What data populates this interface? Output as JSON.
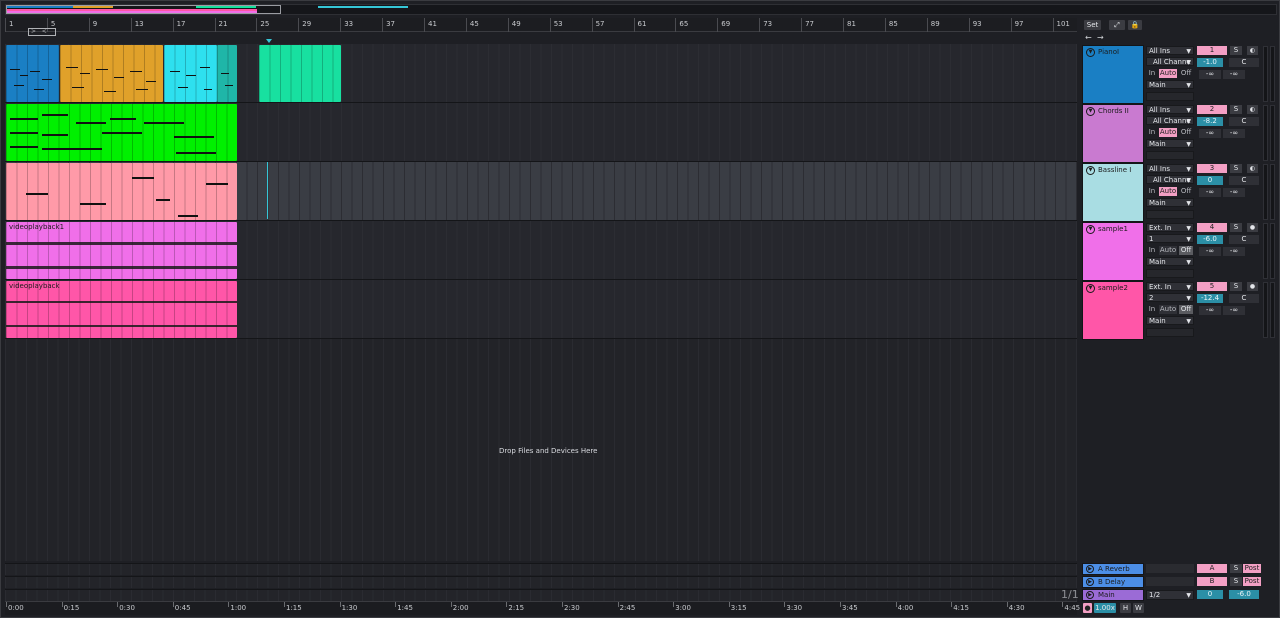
{
  "ruler": {
    "bars": [
      "1",
      "5",
      "9",
      "13",
      "17",
      "21",
      "25",
      "29",
      "33",
      "37",
      "41",
      "45",
      "49",
      "53",
      "57",
      "61",
      "65",
      "69",
      "73",
      "77",
      "81",
      "85",
      "89",
      "93",
      "97",
      "101"
    ]
  },
  "timeline": {
    "labels": [
      "0:00",
      "0:15",
      "0:30",
      "0:45",
      "1:00",
      "1:15",
      "1:30",
      "1:45",
      "2:00",
      "2:15",
      "2:30",
      "2:45",
      "3:00",
      "3:15",
      "3:30",
      "3:45",
      "4:00",
      "4:15",
      "4:30",
      "4:45"
    ]
  },
  "tracks": [
    {
      "name": "PianoI",
      "color": "#1a7fc4",
      "input": "All Ins",
      "channel": "All Channe",
      "monitor_in": "In",
      "monitor_auto": "Auto",
      "monitor_off": "Off",
      "output": "Main",
      "number": "1",
      "solo": "S",
      "vol": "-1.0",
      "pan": "C",
      "send_a": "-∞",
      "send_b": "-∞"
    },
    {
      "name": "Chords II",
      "color": "#c97ad0",
      "input": "All Ins",
      "channel": "All Channe",
      "monitor_in": "In",
      "monitor_auto": "Auto",
      "monitor_off": "Off",
      "output": "Main",
      "number": "2",
      "solo": "S",
      "vol": "-8.2",
      "pan": "C",
      "send_a": "-∞",
      "send_b": "-∞"
    },
    {
      "name": "Bassline I",
      "color": "#a9dde3",
      "input": "All Ins",
      "channel": "All Channe",
      "monitor_in": "In",
      "monitor_auto": "Auto",
      "monitor_off": "Off",
      "output": "Main",
      "number": "3",
      "solo": "S",
      "vol": "0",
      "pan": "C",
      "send_a": "-∞",
      "send_b": "-∞"
    },
    {
      "name": "sample1",
      "color": "#f06fe9",
      "input": "Ext. In",
      "channel": "1",
      "monitor_in": "In",
      "monitor_auto": "Auto",
      "monitor_off": "Off",
      "output": "Main",
      "number": "4",
      "solo": "S",
      "vol": "-6.0",
      "pan": "C",
      "send_a": "-∞",
      "send_b": "-∞"
    },
    {
      "name": "sample2",
      "color": "#ff56a8",
      "input": "Ext. In",
      "channel": "2",
      "monitor_in": "In",
      "monitor_auto": "Auto",
      "monitor_off": "Off",
      "output": "Main",
      "number": "5",
      "solo": "S",
      "vol": "-12.4",
      "pan": "C",
      "send_a": "-∞",
      "send_b": "-∞"
    }
  ],
  "clips": {
    "video1": "videoplayback1",
    "video2": "videoplayback"
  },
  "drop_hint": "Drop Files and Devices Here",
  "returns": [
    {
      "name": "A Reverb",
      "letter": "A",
      "solo": "S",
      "post": "Post",
      "color": "#4c8ee6"
    },
    {
      "name": "B Delay",
      "letter": "B",
      "solo": "S",
      "post": "Post",
      "color": "#4c8ee6"
    }
  ],
  "main": {
    "name": "Main",
    "color": "#9b6bd6",
    "output": "1/2",
    "vol": "0",
    "pan": "-6.0"
  },
  "mixer_top": {
    "set": "Set"
  },
  "page_count": "1/1",
  "global": {
    "tempo": "1.00x",
    "h": "H",
    "w": "W"
  },
  "icons": {
    "fold": "fold-triangle-icon",
    "record": "record-arm-icon",
    "expand": "expand-icon",
    "lock": "lock-icon"
  }
}
